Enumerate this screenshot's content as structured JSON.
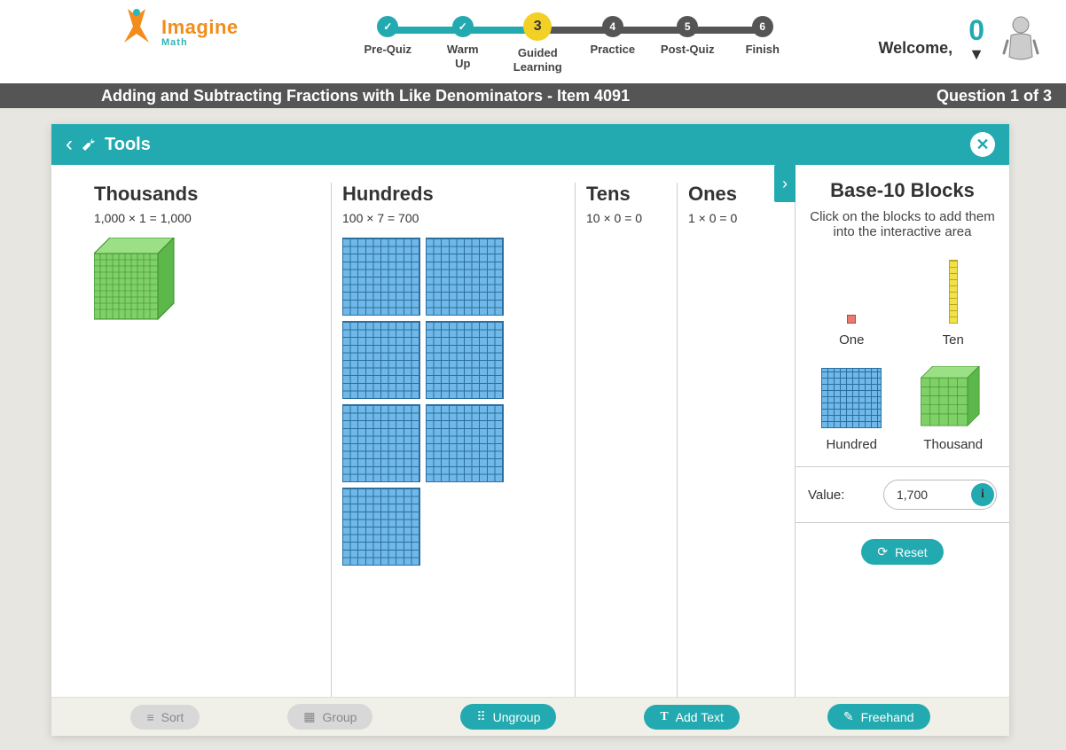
{
  "logo": {
    "brand": "Imagine",
    "sub": "Math"
  },
  "progress": {
    "steps": [
      {
        "label": "Pre-Quiz",
        "num": "✓",
        "state": "done"
      },
      {
        "label": "Warm Up",
        "num": "✓",
        "state": "done"
      },
      {
        "label": "Guided Learning",
        "num": "3",
        "state": "current"
      },
      {
        "label": "Practice",
        "num": "4",
        "state": ""
      },
      {
        "label": "Post-Quiz",
        "num": "5",
        "state": ""
      },
      {
        "label": "Finish",
        "num": "6",
        "state": ""
      }
    ]
  },
  "header": {
    "welcome": "Welcome,",
    "points": "0"
  },
  "titlebar": {
    "left": "Adding and Subtracting Fractions with Like Denominators - Item 4091",
    "right": "Question 1 of 3"
  },
  "tools": {
    "title": "Tools"
  },
  "columns": {
    "thousands": {
      "title": "Thousands",
      "eq": "1,000 × 1 = 1,000",
      "count": 1
    },
    "hundreds": {
      "title": "Hundreds",
      "eq": "100 × 7 = 700",
      "count": 7
    },
    "tens": {
      "title": "Tens",
      "eq": "10 × 0 = 0",
      "count": 0
    },
    "ones": {
      "title": "Ones",
      "eq": "1 × 0 = 0",
      "count": 0
    }
  },
  "sidebar": {
    "title": "Base-10 Blocks",
    "hint": "Click on the blocks to add them into the interactive area",
    "palette": {
      "one": "One",
      "ten": "Ten",
      "hundred": "Hundred",
      "thousand": "Thousand"
    },
    "value_label": "Value:",
    "value": "1,700",
    "reset": "Reset"
  },
  "toolbar": {
    "sort": "Sort",
    "group": "Group",
    "ungroup": "Ungroup",
    "addtext": "Add Text",
    "freehand": "Freehand"
  }
}
